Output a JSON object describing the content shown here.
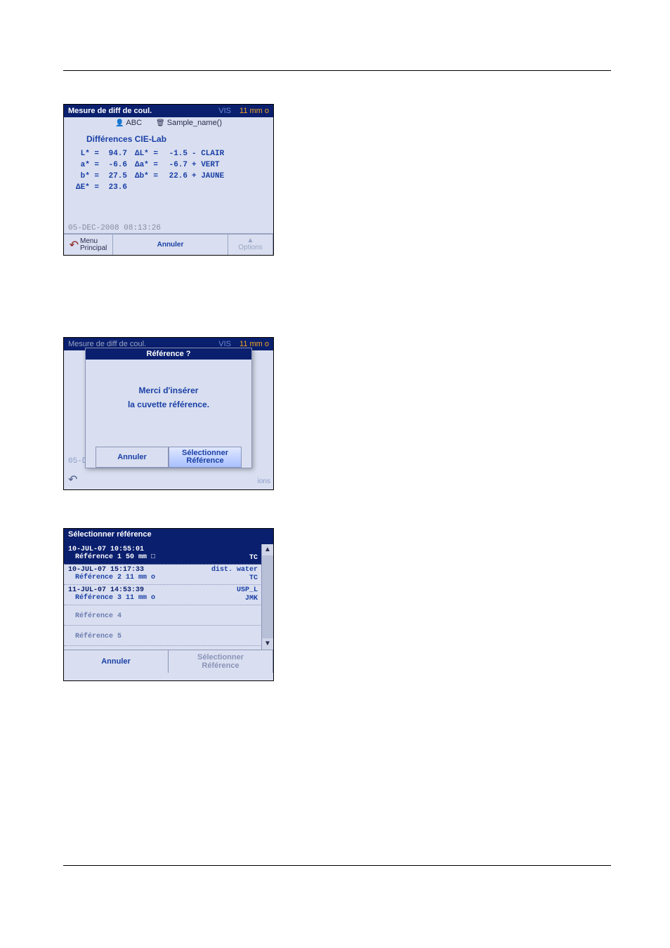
{
  "screen1": {
    "title": "Mesure de diff de coul.",
    "vis": "VIS",
    "cuvette": "11 mm o",
    "abc": "ABC",
    "sample": "Sample_name()",
    "subtitle": "Différences CIE-Lab",
    "rows": [
      {
        "lbl": "L* =",
        "v1": "94.7",
        "lbl2": "ΔL* =",
        "v2": "-1.5",
        "txt": "- CLAIR"
      },
      {
        "lbl": "a* =",
        "v1": "-6.6",
        "lbl2": "Δa* =",
        "v2": "-6.7",
        "txt": "+ VERT"
      },
      {
        "lbl": "b* =",
        "v1": "27.5",
        "lbl2": "Δb* =",
        "v2": "22.6",
        "txt": "+ JAUNE"
      },
      {
        "lbl": "ΔE* =",
        "v1": "23.6",
        "lbl2": "",
        "v2": "",
        "txt": ""
      }
    ],
    "timestamp": "05-DEC-2008  08:13:26",
    "home1": "Menu",
    "home2": "Principal",
    "annuler": "Annuler",
    "options": "Options"
  },
  "screen2": {
    "bgtitle": "Mesure de diff de coul.",
    "bgvis": "VIS",
    "bgcuv": "11 mm o",
    "dlgtitle": "Référence ?",
    "line1": "Merci d'insérer",
    "line2": "la cuvette référence.",
    "annuler": "Annuler",
    "select1": "Sélectionner",
    "select2": "Référence",
    "tsfrag": "05-D",
    "ions": "ions"
  },
  "screen3": {
    "title": "Sélectionner référence",
    "rows": [
      {
        "ts": "10-JUL-07  10:55:01",
        "name": "Référence 1  50 mm □",
        "r1": "",
        "r2": "TC"
      },
      {
        "ts": "10-JUL-07  15:17:33",
        "name": "Référence 2  11 mm o",
        "r1": "dist. water",
        "r2": "TC"
      },
      {
        "ts": "11-JUL-07  14:53:39",
        "name": "Référence 3  11 mm o",
        "r1": "USP_L",
        "r2": "JMK"
      },
      {
        "ts": "",
        "name": "Référence 4",
        "r1": "",
        "r2": ""
      },
      {
        "ts": "",
        "name": "Référence 5",
        "r1": "",
        "r2": ""
      }
    ],
    "annuler": "Annuler",
    "select1": "Sélectionner",
    "select2": "Référence"
  }
}
